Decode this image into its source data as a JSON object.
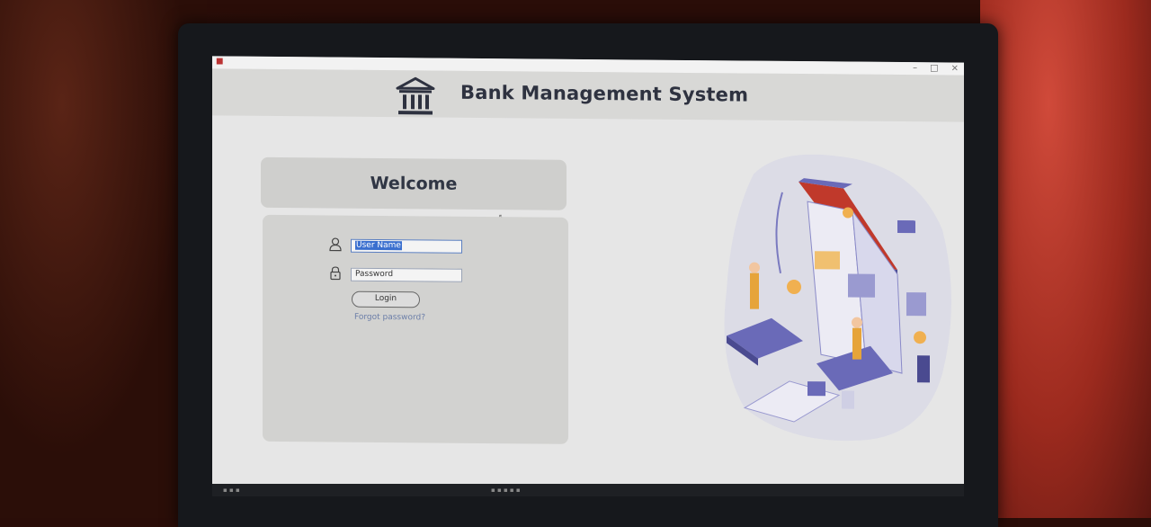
{
  "window": {
    "app_title": "Bank Management System",
    "controls": [
      "–",
      "□",
      "×"
    ]
  },
  "welcome": "Welcome",
  "login": {
    "username_value": "User Name",
    "password_value": "Password",
    "login_label": "Login",
    "forgot_label": "Forgot password?"
  },
  "icons": {
    "brand": "bank-building-icon",
    "user": "user-icon",
    "lock": "lock-icon"
  },
  "colors": {
    "header_bg": "#d8d8d6",
    "panel_bg": "#d2d2d0",
    "title_text": "#2e3240",
    "illustration_accent": "#6a6ab8",
    "illustration_roof": "#c0392b"
  }
}
